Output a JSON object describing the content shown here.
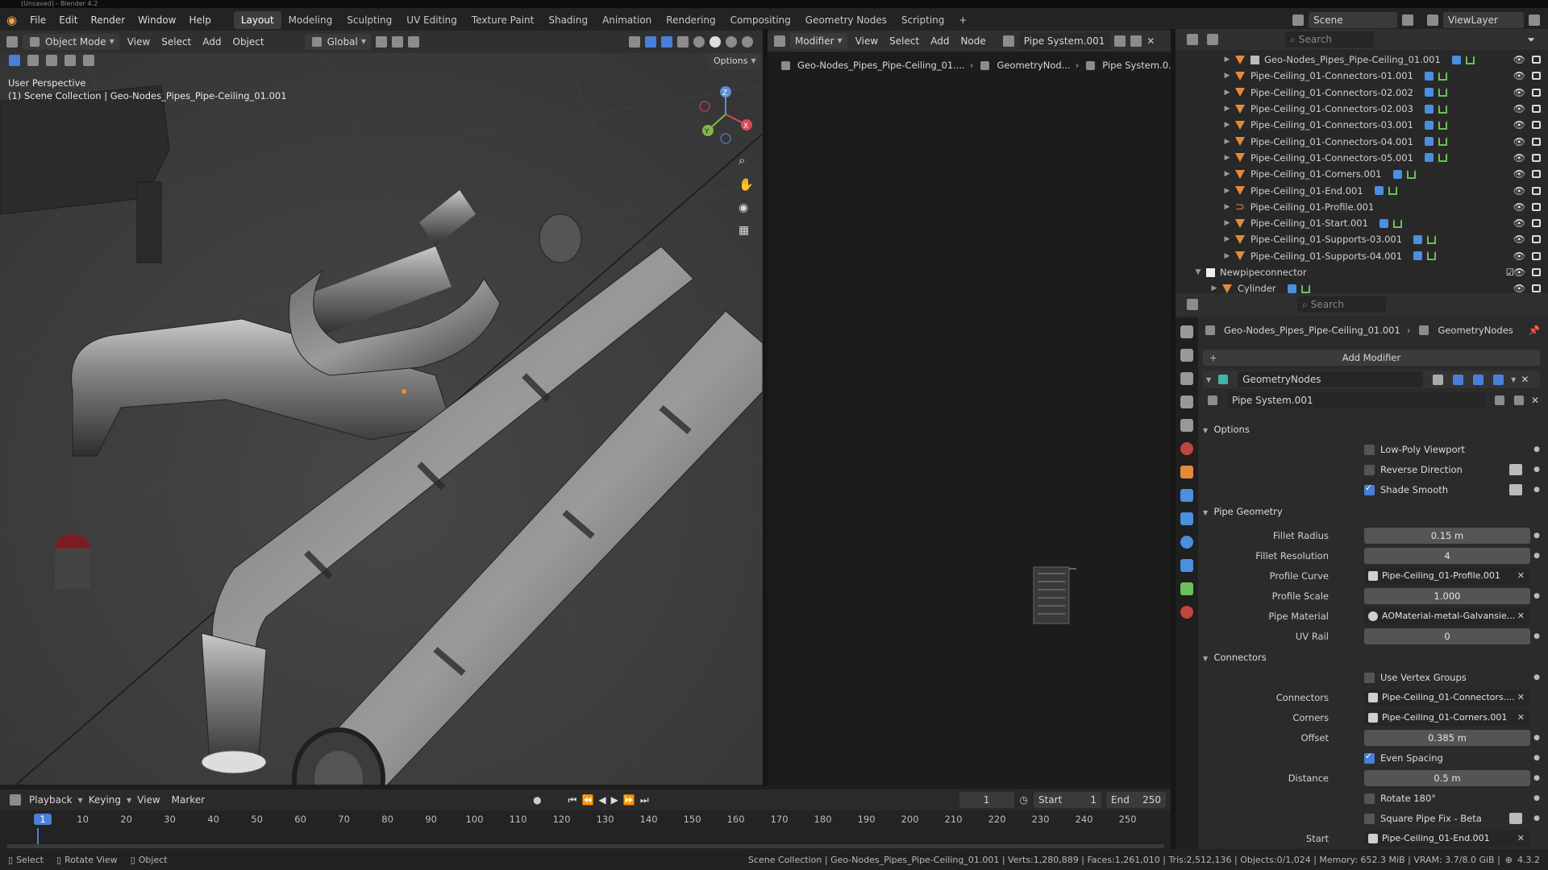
{
  "window": {
    "title": "(Unsaved) - Blender 4.2"
  },
  "menu": [
    "File",
    "Edit",
    "Render",
    "Window",
    "Help"
  ],
  "workspaces": [
    "Layout",
    "Modeling",
    "Sculpting",
    "UV Editing",
    "Texture Paint",
    "Shading",
    "Animation",
    "Rendering",
    "Compositing",
    "Geometry Nodes",
    "Scripting",
    "+"
  ],
  "scene": {
    "scene_label": "Scene",
    "viewlayer_label": "ViewLayer"
  },
  "viewport": {
    "mode": "Object Mode",
    "menus": [
      "View",
      "Select",
      "Add",
      "Object"
    ],
    "transform": "Global",
    "options": "Options",
    "overlay1": "User Perspective",
    "overlay2": "(1) Scene Collection | Geo-Nodes_Pipes_Pipe-Ceiling_01.001",
    "gizmo": {
      "x": "X",
      "y": "Y",
      "z": "Z"
    }
  },
  "node_editor": {
    "type": "Modifier",
    "menus": [
      "View",
      "Select",
      "Add",
      "Node"
    ],
    "tree": "Pipe System.001",
    "breadcrumb": [
      "Geo-Nodes_Pipes_Pipe-Ceiling_01....",
      "GeometryNod...",
      "Pipe System.0..."
    ]
  },
  "outliner": {
    "search": "Search",
    "rows": [
      {
        "name": "Geo-Nodes_Pipes_Pipe-Ceiling_01.001",
        "type": "mesh"
      },
      {
        "name": "Pipe-Ceiling_01-Connectors-01.001",
        "type": "obj"
      },
      {
        "name": "Pipe-Ceiling_01-Connectors-02.002",
        "type": "obj"
      },
      {
        "name": "Pipe-Ceiling_01-Connectors-02.003",
        "type": "obj"
      },
      {
        "name": "Pipe-Ceiling_01-Connectors-03.001",
        "type": "obj"
      },
      {
        "name": "Pipe-Ceiling_01-Connectors-04.001",
        "type": "obj"
      },
      {
        "name": "Pipe-Ceiling_01-Connectors-05.001",
        "type": "obj"
      },
      {
        "name": "Pipe-Ceiling_01-Corners.001",
        "type": "obj"
      },
      {
        "name": "Pipe-Ceiling_01-End.001",
        "type": "obj"
      },
      {
        "name": "Pipe-Ceiling_01-Profile.001",
        "type": "curve"
      },
      {
        "name": "Pipe-Ceiling_01-Start.001",
        "type": "obj"
      },
      {
        "name": "Pipe-Ceiling_01-Supports-03.001",
        "type": "obj"
      },
      {
        "name": "Pipe-Ceiling_01-Supports-04.001",
        "type": "obj"
      },
      {
        "name": "Newpipeconnector",
        "type": "collection"
      },
      {
        "name": "Cylinder",
        "type": "obj"
      }
    ]
  },
  "properties": {
    "search": "Search",
    "breadcrumb_obj": "Geo-Nodes_Pipes_Pipe-Ceiling_01.001",
    "breadcrumb_mod": "GeometryNodes",
    "add_modifier": "Add Modifier",
    "modifier_name": "GeometryNodes",
    "node_group": "Pipe System.001",
    "options_label": "Options",
    "low_poly": "Low-Poly Viewport",
    "reverse": "Reverse Direction",
    "shade_smooth": "Shade Smooth",
    "pipe_geometry_label": "Pipe Geometry",
    "fillet_radius_label": "Fillet Radius",
    "fillet_radius": "0.15 m",
    "fillet_res_label": "Fillet Resolution",
    "fillet_res": "4",
    "profile_curve_label": "Profile Curve",
    "profile_curve": "Pipe-Ceiling_01-Profile.001",
    "profile_scale_label": "Profile Scale",
    "profile_scale": "1.000",
    "pipe_material_label": "Pipe Material",
    "pipe_material": "AOMaterial-metal-Galvansie...",
    "uv_rail_label": "UV Rail",
    "uv_rail": "0",
    "connectors_section": "Connectors",
    "use_vgroups": "Use Vertex Groups",
    "connectors_label": "Connectors",
    "connectors": "Pipe-Ceiling_01-Connectors....",
    "corners_label": "Corners",
    "corners": "Pipe-Ceiling_01-Corners.001",
    "offset_label": "Offset",
    "offset": "0.385 m",
    "even_spacing": "Even Spacing",
    "distance_label": "Distance",
    "distance": "0.5 m",
    "rotate": "Rotate 180°",
    "square_fix": "Square Pipe Fix - Beta",
    "start_label": "Start",
    "start": "Pipe-Ceiling_01-End.001"
  },
  "timeline": {
    "menus": [
      "Playback",
      "Keying",
      "View",
      "Marker"
    ],
    "current": "1",
    "start_label": "Start",
    "start": "1",
    "end_label": "End",
    "end": "250",
    "ticks": [
      "1",
      "10",
      "20",
      "30",
      "40",
      "50",
      "60",
      "70",
      "80",
      "90",
      "100",
      "110",
      "120",
      "130",
      "140",
      "150",
      "160",
      "170",
      "180",
      "190",
      "200",
      "210",
      "220",
      "230",
      "240",
      "250"
    ]
  },
  "status": {
    "select": "Select",
    "rotate": "Rotate View",
    "object": "Object",
    "info": "Scene Collection | Geo-Nodes_Pipes_Pipe-Ceiling_01.001 | Verts:1,280,889 | Faces:1,261,010 | Tris:2,512,136 | Objects:0/1,024 | Memory: 652.3 MiB | VRAM: 3.7/8.0 GiB |",
    "version": "4.3.2"
  }
}
